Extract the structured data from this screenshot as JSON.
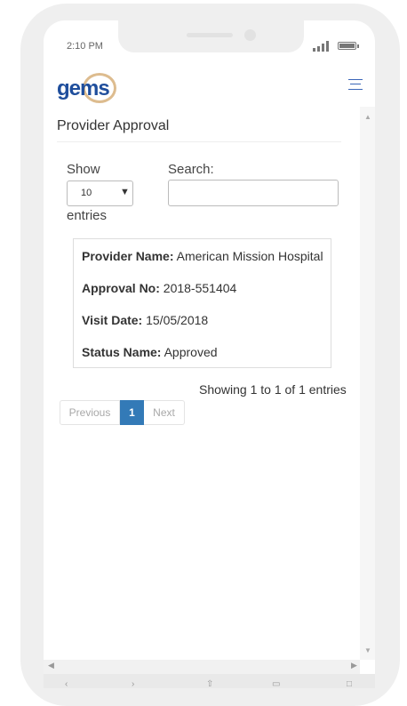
{
  "status_bar": {
    "time": "2:10 PM"
  },
  "header": {
    "logo_text": "gems",
    "menu_icon": "hamburger-menu-icon"
  },
  "page": {
    "title": "Provider Approval"
  },
  "table_controls": {
    "show_label": "Show",
    "length_value": "10",
    "entries_label": "entries",
    "search_label": "Search:",
    "search_value": ""
  },
  "record": {
    "provider_name_label": "Provider Name:",
    "provider_name_value": "American Mission Hospital",
    "approval_no_label": "Approval No:",
    "approval_no_value": "2018-551404",
    "visit_date_label": "Visit Date:",
    "visit_date_value": "15/05/2018",
    "status_name_label": "Status Name:",
    "status_name_value": "Approved"
  },
  "table_info": "Showing 1 to 1 of 1 entries",
  "pagination": {
    "previous": "Previous",
    "current": "1",
    "next": "Next"
  },
  "colors": {
    "accent": "#337ab7",
    "logo_blue": "#1f4e9c",
    "logo_ring": "#d1a56a"
  }
}
